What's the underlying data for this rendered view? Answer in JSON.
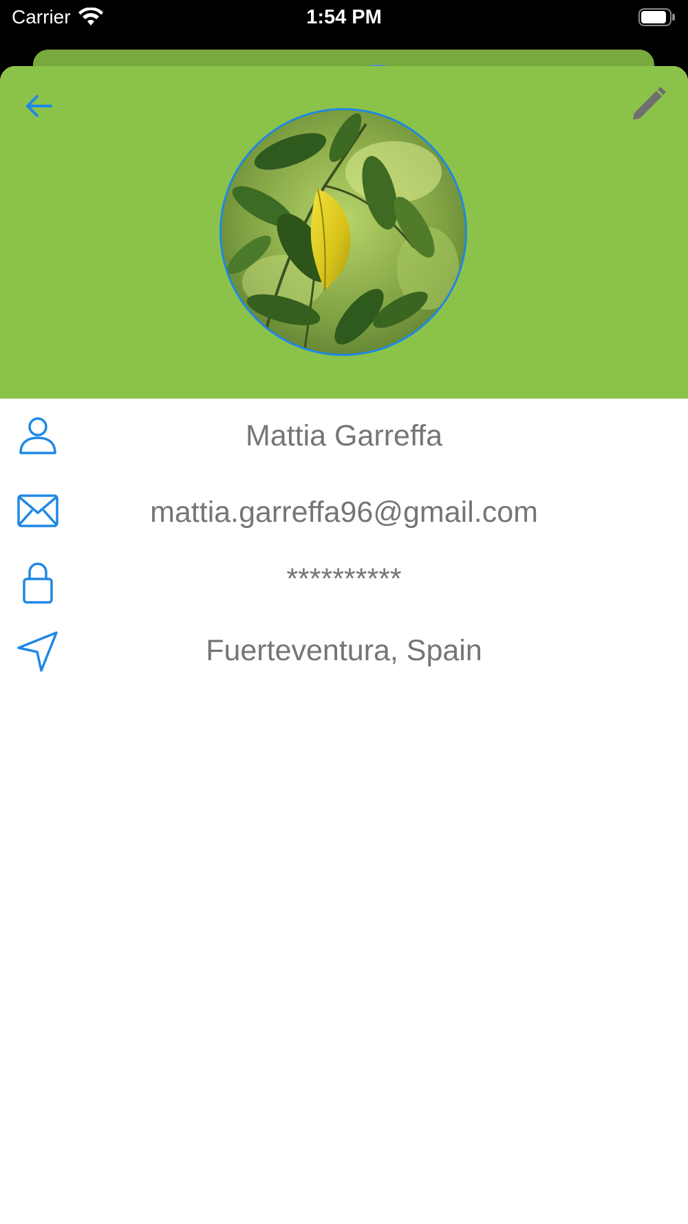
{
  "status_bar": {
    "carrier": "Carrier",
    "time": "1:54 PM"
  },
  "header": {
    "background_color": "#8bc34a",
    "accent_color": "#1e88e5",
    "back_icon": "arrow-left-icon",
    "edit_icon": "pencil-icon",
    "avatar_image": "plant-leaves-photo"
  },
  "profile": {
    "name": "Mattia Garreffa",
    "email": "mattia.garreffa96@gmail.com",
    "password": "**********",
    "location": "Fuerteventura, Spain"
  },
  "icons": {
    "name": "user-icon",
    "email": "mail-icon",
    "password": "lock-icon",
    "location": "navigation-arrow-icon"
  },
  "text_color": "#757575"
}
